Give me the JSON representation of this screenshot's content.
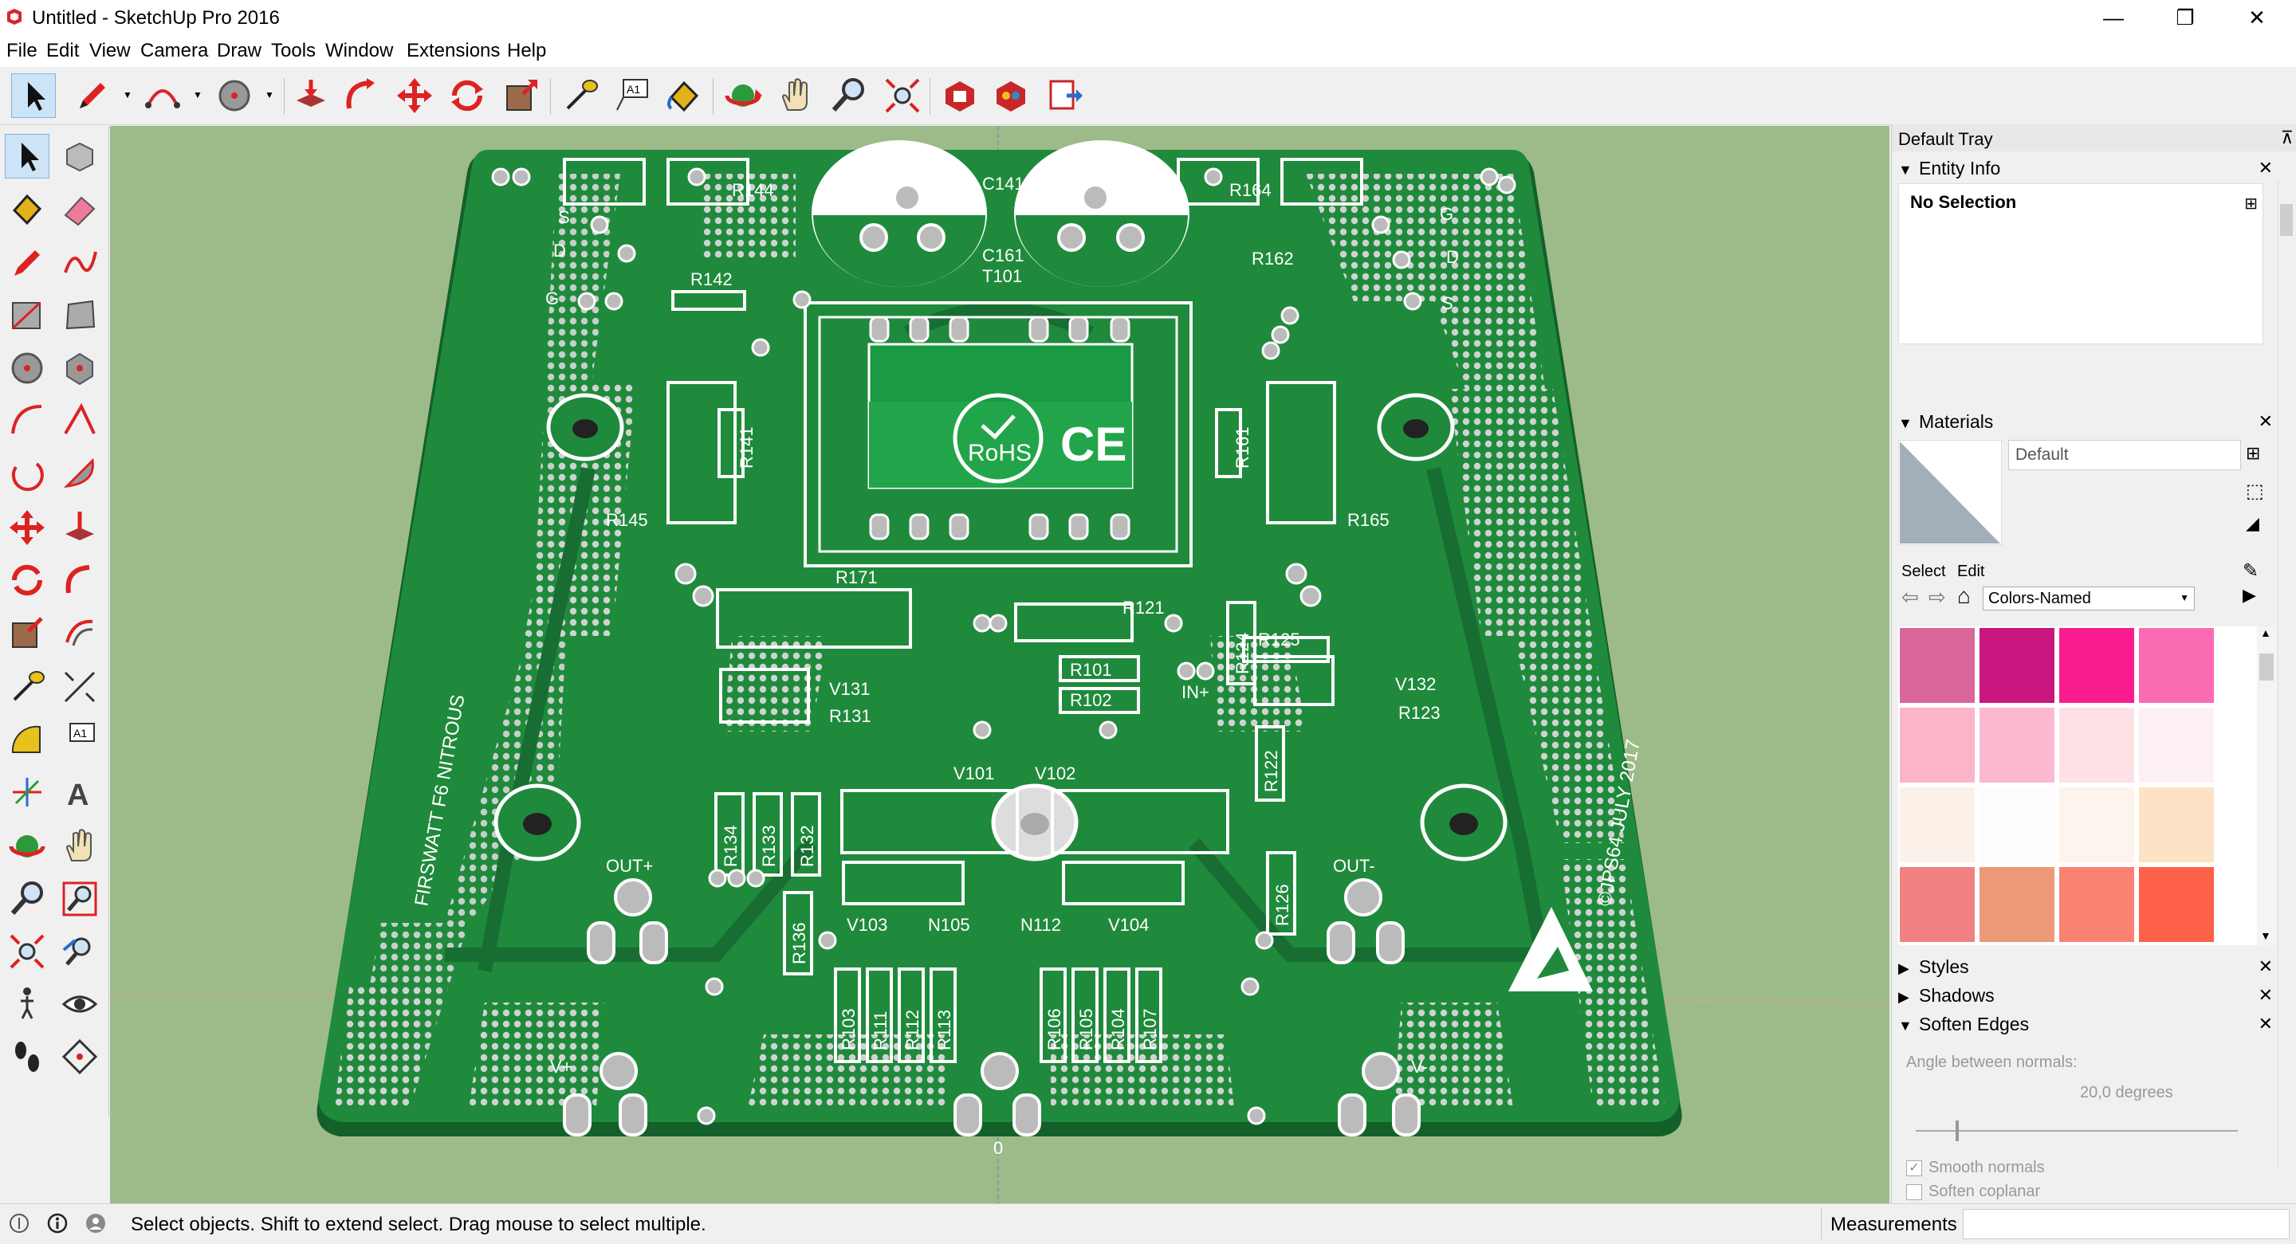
{
  "window": {
    "title": "Untitled - SketchUp Pro 2016",
    "controls": [
      "—",
      "❐",
      "✕"
    ]
  },
  "menu": [
    "File",
    "Edit",
    "View",
    "Camera",
    "Draw",
    "Tools",
    "Window",
    "Extensions",
    "Help"
  ],
  "pcb": {
    "board_color": "#1f8a3c",
    "silk_color": "#ffffff",
    "labels": {
      "r144": "R144",
      "r164": "R164",
      "c141": "C141",
      "c161": "C161",
      "t101": "T101",
      "r142": "R142",
      "r162": "R162",
      "r141": "R141",
      "r161": "R161",
      "r145": "R145",
      "r165": "R165",
      "r171": "R171",
      "r121": "R121",
      "r125": "R125",
      "r124": "R124",
      "r101": "R101",
      "r102": "R102",
      "in": "IN+",
      "v131": "V131",
      "r131": "R131",
      "v132": "V132",
      "r123": "R123",
      "r122": "R122",
      "v101": "V101",
      "v102": "V102",
      "r134": "R134",
      "r133": "R133",
      "r132": "R132",
      "r136": "R136",
      "v103": "V103",
      "n105": "N105",
      "n112": "N112",
      "v104": "V104",
      "r126": "R126",
      "outp": "OUT+",
      "outm": "OUT-",
      "r103": "R103",
      "r111": "R111",
      "r112": "R112",
      "r113": "R113",
      "r106": "R106",
      "r105": "R105",
      "r104": "R104",
      "r107": "R107",
      "vp": "V+",
      "vm": "V-",
      "gnd": "0",
      "rohs": "RoHS",
      "ce": "CE",
      "left_text": "FIRSWATT F6 NITROUS",
      "right_text": "©JPS64 JULY 2017",
      "s1": "S",
      "d1": "D",
      "g1": "G",
      "s2": "S",
      "d2": "D",
      "g2": "G"
    }
  },
  "tray": {
    "title": "Default Tray",
    "entity_info": {
      "header": "Entity Info",
      "value": "No Selection"
    },
    "materials": {
      "header": "Materials",
      "material_name": "Default",
      "tabs": [
        "Select",
        "Edit"
      ],
      "library": "Colors-Named",
      "swatches": [
        "#d9679a",
        "#c9157e",
        "#fa1c8f",
        "#fb6bb4",
        "#fcb5c8",
        "#fbb9d1",
        "#fde1e5",
        "#fdf0f4",
        "#fbf1e9",
        "#fefcfd",
        "#fdf4ee",
        "#fee2c6",
        "#f18182",
        "#ec9978",
        "#fa8271",
        "#fd6147"
      ]
    },
    "styles": "Styles",
    "shadows": "Shadows",
    "soften_edges": {
      "header": "Soften Edges",
      "angle_label": "Angle between normals:",
      "angle_value": "20,0  degrees",
      "smooth_normals": "Smooth normals",
      "soften_coplanar": "Soften coplanar"
    }
  },
  "status": {
    "message": "Select objects. Shift to extend select. Drag mouse to select multiple.",
    "measurements_label": "Measurements"
  }
}
